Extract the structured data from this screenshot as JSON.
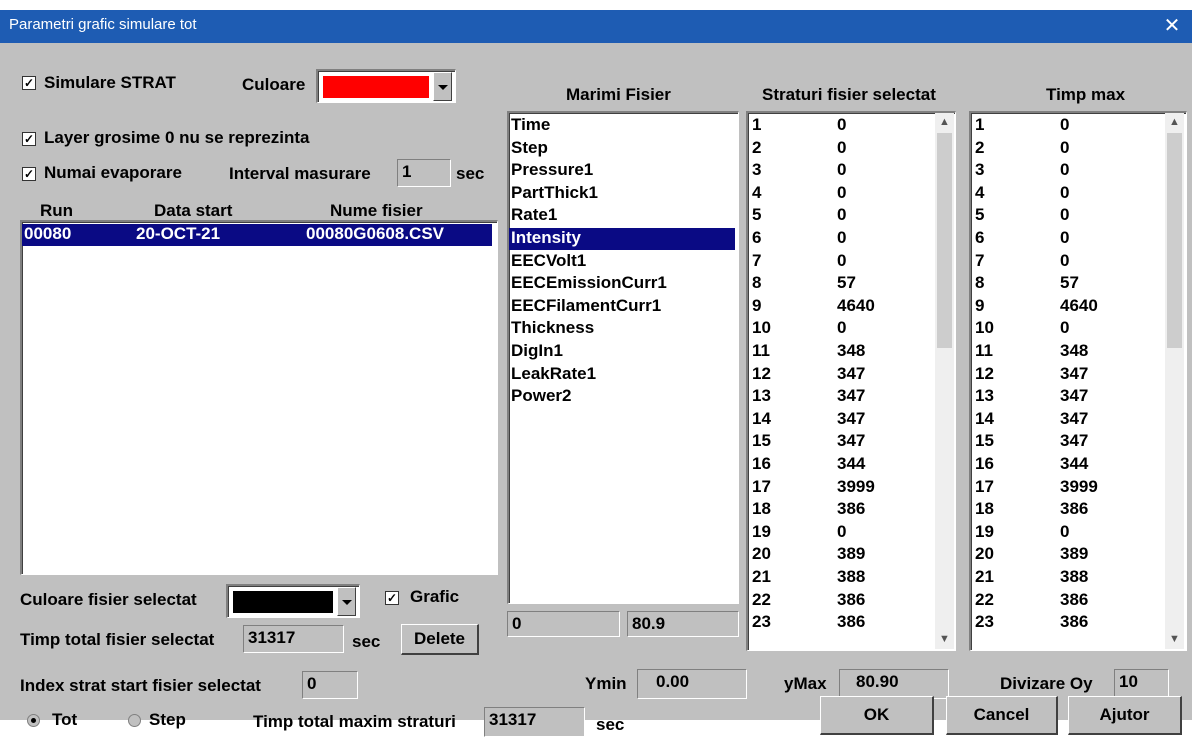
{
  "title": "Parametri grafic simulare tot",
  "simulare_strat": {
    "label": "Simulare STRAT",
    "checked": true
  },
  "culoare": {
    "label": "Culoare",
    "color": "#ff0000"
  },
  "layer_grosime": {
    "label": "Layer grosime 0 nu se reprezinta",
    "checked": true
  },
  "numai_evaporare": {
    "label": "Numai evaporare",
    "checked": true
  },
  "interval": {
    "label": "Interval masurare",
    "value": "1",
    "unit": "sec"
  },
  "runs_table": {
    "headers": [
      "Run",
      "Data start",
      "Nume fisier"
    ],
    "rows": [
      {
        "run": "00080",
        "date": "20-OCT-21",
        "file": "00080G0608.CSV"
      }
    ]
  },
  "culoare_fisier": {
    "label": "Culoare fisier selectat",
    "color": "#000000"
  },
  "grafic": {
    "label": "Grafic",
    "checked": true
  },
  "timp_total": {
    "label": "Timp total fisier selectat",
    "value": "31317",
    "unit": "sec"
  },
  "delete_label": "Delete",
  "index_strat": {
    "label": "Index strat start fisier selectat",
    "value": "0"
  },
  "marimi": {
    "header": "Marimi Fisier",
    "items": [
      "Time",
      "Step",
      "Pressure1",
      "PartThick1",
      "Rate1",
      "Intensity",
      "EECVolt1",
      "EECEmissionCurr1",
      "EECFilamentCurr1",
      "Thickness",
      "DigIn1",
      "LeakRate1",
      "Power2"
    ],
    "selected": "Intensity",
    "min": "0",
    "max": "80.9"
  },
  "straturi": {
    "header": "Straturi fisier selectat",
    "rows": [
      [
        "1",
        "0"
      ],
      [
        "2",
        "0"
      ],
      [
        "3",
        "0"
      ],
      [
        "4",
        "0"
      ],
      [
        "5",
        "0"
      ],
      [
        "6",
        "0"
      ],
      [
        "7",
        "0"
      ],
      [
        "8",
        "57"
      ],
      [
        "9",
        "4640"
      ],
      [
        "10",
        "0"
      ],
      [
        "11",
        "348"
      ],
      [
        "12",
        "347"
      ],
      [
        "13",
        "347"
      ],
      [
        "14",
        "347"
      ],
      [
        "15",
        "347"
      ],
      [
        "16",
        "344"
      ],
      [
        "17",
        "3999"
      ],
      [
        "18",
        "386"
      ],
      [
        "19",
        "0"
      ],
      [
        "20",
        "389"
      ],
      [
        "21",
        "388"
      ],
      [
        "22",
        "386"
      ],
      [
        "23",
        "386"
      ]
    ]
  },
  "timp_max": {
    "header": "Timp max",
    "rows": [
      [
        "1",
        "0"
      ],
      [
        "2",
        "0"
      ],
      [
        "3",
        "0"
      ],
      [
        "4",
        "0"
      ],
      [
        "5",
        "0"
      ],
      [
        "6",
        "0"
      ],
      [
        "7",
        "0"
      ],
      [
        "8",
        "57"
      ],
      [
        "9",
        "4640"
      ],
      [
        "10",
        "0"
      ],
      [
        "11",
        "348"
      ],
      [
        "12",
        "347"
      ],
      [
        "13",
        "347"
      ],
      [
        "14",
        "347"
      ],
      [
        "15",
        "347"
      ],
      [
        "16",
        "344"
      ],
      [
        "17",
        "3999"
      ],
      [
        "18",
        "386"
      ],
      [
        "19",
        "0"
      ],
      [
        "20",
        "389"
      ],
      [
        "21",
        "388"
      ],
      [
        "22",
        "386"
      ],
      [
        "23",
        "386"
      ]
    ]
  },
  "ymin": {
    "label": "Ymin",
    "value": "0.00"
  },
  "ymax": {
    "label": "yMax",
    "value": "80.90"
  },
  "divizare": {
    "label": "Divizare Oy",
    "value": "10"
  },
  "radio_tot": {
    "label": "Tot",
    "checked": true
  },
  "radio_step": {
    "label": "Step",
    "checked": false
  },
  "timp_total_maxim": {
    "label": "Timp total maxim straturi",
    "value": "31317",
    "unit": "sec"
  },
  "ok_label": "OK",
  "cancel_label": "Cancel",
  "ajutor_label": "Ajutor",
  "colors": {
    "titlebar": "#1e5cb3",
    "selection": "#0a0a84",
    "dialog": "#c0c0c0"
  }
}
